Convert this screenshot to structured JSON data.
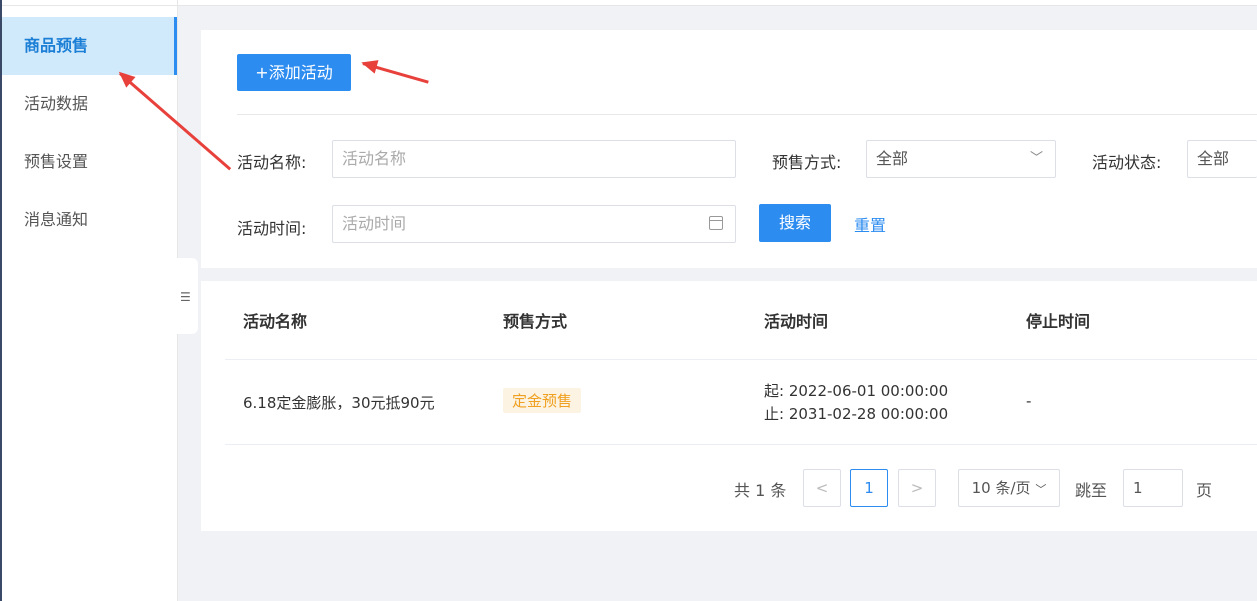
{
  "sidebar": {
    "items": [
      {
        "label": "商品预售",
        "active": true
      },
      {
        "label": "活动数据",
        "active": false
      },
      {
        "label": "预售设置",
        "active": false
      },
      {
        "label": "消息通知",
        "active": false
      }
    ],
    "collapse_icon": "indent-icon"
  },
  "toolbar": {
    "add_label": "+添加活动"
  },
  "filters": {
    "name_label": "活动名称:",
    "name_placeholder": "活动名称",
    "presale_label": "预售方式:",
    "presale_value": "全部",
    "status_label": "活动状态:",
    "status_value": "全部",
    "time_label": "活动时间:",
    "time_placeholder": "活动时间",
    "search_label": "搜索",
    "reset_label": "重置"
  },
  "table": {
    "headers": [
      "活动名称",
      "预售方式",
      "活动时间",
      "停止时间"
    ],
    "rows": [
      {
        "name": "6.18定金膨胀，30元抵90元",
        "presale": "定金预售",
        "start": "起:  2022-06-01 00:00:00",
        "end": "止:  2031-02-28 00:00:00",
        "stop": "-"
      }
    ]
  },
  "pagination": {
    "total": "共 1 条",
    "prev": "<",
    "current": "1",
    "next": ">",
    "page_size": "10 条/页",
    "jump_label": "跳至",
    "jump_value": "1",
    "page_suffix": "页"
  },
  "colors": {
    "primary": "#2d8cf0",
    "annotation_arrow": "#e8413c",
    "tag_text": "#f0a020"
  }
}
